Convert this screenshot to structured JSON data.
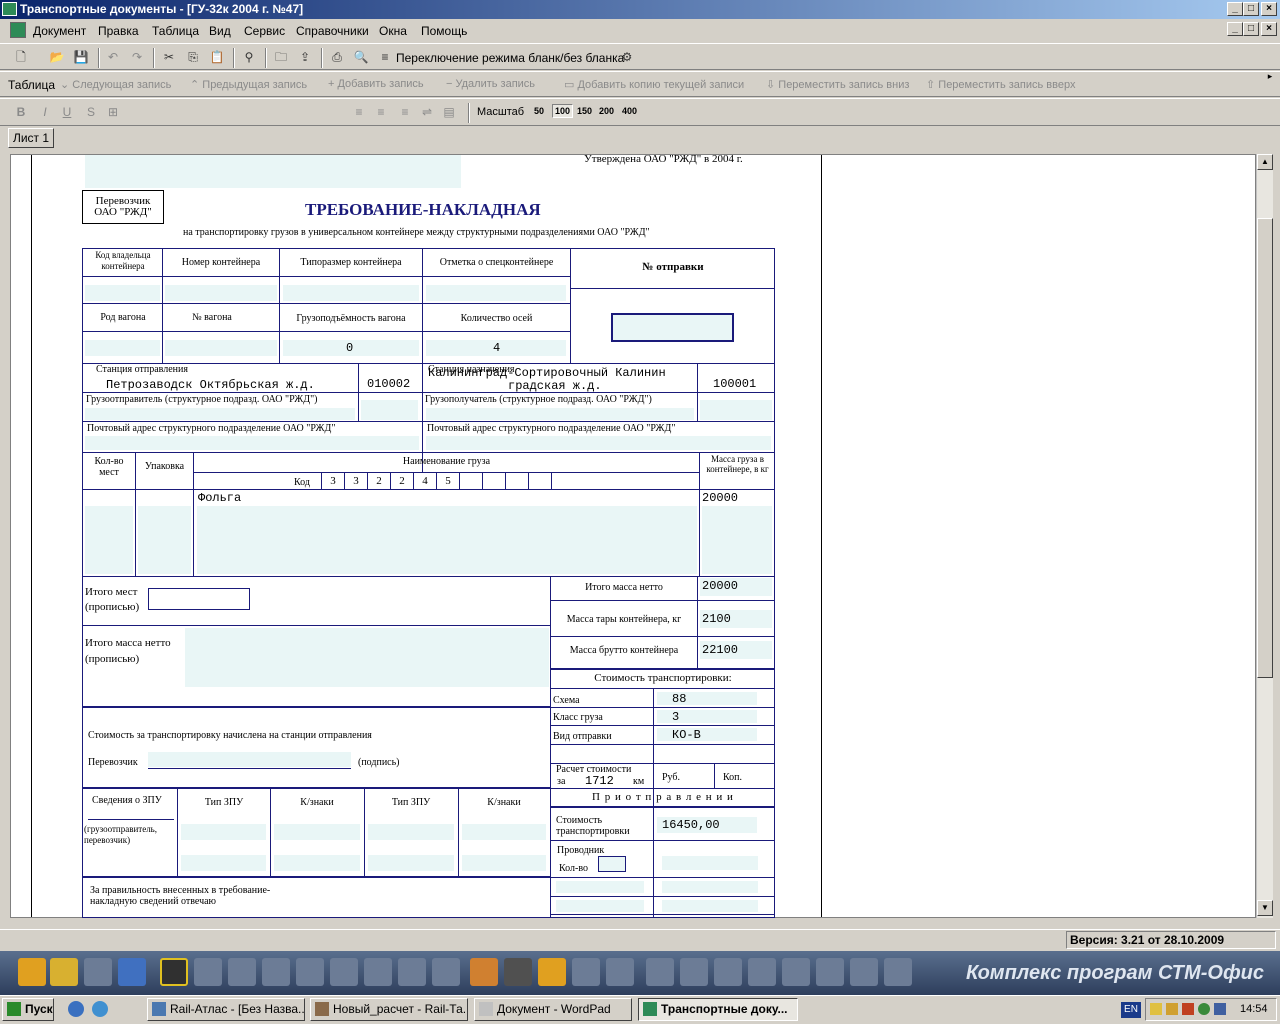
{
  "window": {
    "title": "Транспортные документы - [ГУ-32к 2004 г. №47]"
  },
  "menu": [
    "Документ",
    "Правка",
    "Таблица",
    "Вид",
    "Сервис",
    "Справочники",
    "Окна",
    "Помощь"
  ],
  "toolbar1": {
    "mode_toggle": "Переключение режима бланк/без бланка"
  },
  "toolbar2": {
    "table_label": "Таблица",
    "next": "Следующая запись",
    "prev": "Предыдущая запись",
    "add": "Добавить запись",
    "delete": "Удалить запись",
    "copy": "Добавить копию текущей записи",
    "move_down": "Переместить запись вниз",
    "move_up": "Переместить запись вверх"
  },
  "toolbar3": {
    "scale_label": "Масштаб",
    "scales": [
      "50",
      "100",
      "150",
      "200",
      "400"
    ],
    "selected_scale": "100"
  },
  "sheet_tab": "Лист 1",
  "form": {
    "approved": "Утверждена ОАО \"РЖД\" в 2004 г.",
    "carrier_box": "Перевозчик ОАО \"РЖД\"",
    "title": "ТРЕБОВАНИЕ-НАКЛАДНАЯ",
    "subtitle": "на транспортировку грузов в универсальном контейнере между структурными подразделениями ОАО \"РЖД\"",
    "h_owner": "Код владельца контейнера",
    "h_cont_no": "Номер контейнера",
    "h_size": "Типоразмер контейнера",
    "h_special": "Отметка о спецконтейнере",
    "h_dispatch_no": "№ отправки",
    "h_wagon_kind": "Род вагона",
    "h_wagon_no": "№ вагона",
    "h_capacity": "Грузоподъёмность вагона",
    "h_axles": "Количество осей",
    "capacity": "0",
    "axles": "4",
    "h_dep_station": "Станция отправления",
    "dep_station": "Петрозаводск Октябрьская ж.д.",
    "dep_code": "010002",
    "h_dest_station": "Станция назначения",
    "dest_station_1": "Калининград-Сортировочный Калинин",
    "dest_station_2": "градская ж.д.",
    "dest_code": "100001",
    "h_shipper": "Грузоотправитель (структурное подразд. ОАО \"РЖД\")",
    "h_consignee": "Грузополучатель  (структурное подразд. ОАО \"РЖД\")",
    "h_addr1": "Почтовый адрес структурного подразделение ОАО \"РЖД\"",
    "h_addr2": "Почтовый адрес структурного подразделение ОАО \"РЖД\"",
    "h_places": "Кол-во мест",
    "h_pack": "Упаковка",
    "h_cargo": "Наименование груза",
    "h_code": "Код",
    "code_digits": [
      "3",
      "3",
      "2",
      "2",
      "4",
      "5"
    ],
    "h_mass": "Масса груза в контейнере, в кг",
    "cargo": "Фольга",
    "mass": "20000",
    "h_total_places": "Итого мест (прописью)",
    "h_total_net": "Итого масса нетто",
    "total_net": "20000",
    "h_tare": "Масса тары контейнера, кг",
    "tare": "2100",
    "h_gross": "Масса брутто контейнера",
    "gross": "22100",
    "h_net_words": "Итого масса нетто (прописью)",
    "h_cost": "Стоимость транспортировки:",
    "h_scheme": "Схема",
    "scheme": "88",
    "h_class": "Класс груза",
    "class": "3",
    "h_kind": "Вид отправки",
    "kind": "КО-В",
    "h_calc": "Расчет стоимости",
    "calc_za": "за",
    "calc_km_val": "1712",
    "calc_km": "км",
    "h_rub": "Руб.",
    "h_kop": "Коп.",
    "cost_note": "Стоимость за транспортировку начислена на станции отправления",
    "carrier_label": "Перевозчик",
    "signature": "(подпись)",
    "h_on_departure": "П р и   о т п р а в л е н и и",
    "h_transport_cost": "Стоимость транспортировки",
    "transport_cost": "16450,00",
    "h_zpu": "Сведения о ЗПУ",
    "zpu_note": "(грузоотправитель, перевозчик)",
    "h_zpu_type": "Тип ЗПУ",
    "h_zpu_marks": "К/знаки",
    "h_escort": "Проводник",
    "h_escort_count": "Кол-во",
    "correct": "За правильность внесенных в требование-накладную сведений отвечаю"
  },
  "status": {
    "version": "Версия: 3.21 от 28.10.2009"
  },
  "banner": {
    "text": "Комплекс програм СТМ-Офис"
  },
  "taskbar": {
    "start": "Пуск",
    "items": [
      "Rail-Атлас - [Без Назва...",
      "Новый_расчет - Rail-Та...",
      "Документ - WordPad",
      "Транспортные доку..."
    ],
    "lang": "EN",
    "clock": "14:54"
  }
}
